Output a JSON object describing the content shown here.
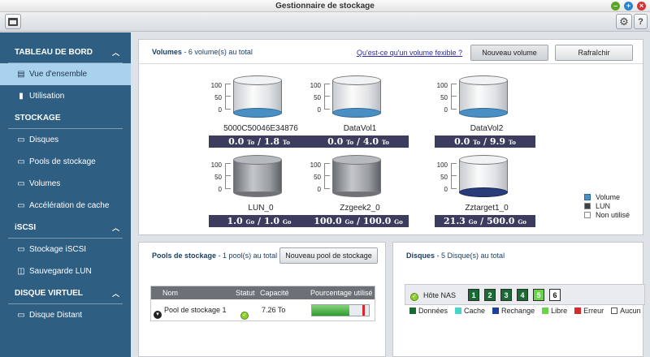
{
  "window": {
    "title": "Gestionnaire de stockage"
  },
  "sidebar": {
    "sections": [
      {
        "label": "TABLEAU DE BORD",
        "items": [
          {
            "label": "Vue d'ensemble",
            "icon": "overview-icon"
          },
          {
            "label": "Utilisation",
            "icon": "chart-icon"
          }
        ]
      },
      {
        "label": "STOCKAGE",
        "items": [
          {
            "label": "Disques",
            "icon": "disk-icon"
          },
          {
            "label": "Pools de stockage",
            "icon": "pool-icon"
          },
          {
            "label": "Volumes",
            "icon": "volume-icon"
          },
          {
            "label": "Accélération de cache",
            "icon": "cache-icon"
          }
        ]
      },
      {
        "label": "iSCSI",
        "items": [
          {
            "label": "Stockage iSCSI",
            "icon": "iscsi-icon"
          },
          {
            "label": "Sauvegarde LUN",
            "icon": "backup-icon"
          }
        ]
      },
      {
        "label": "DISQUE VIRTUEL",
        "items": [
          {
            "label": "Disque Distant",
            "icon": "remote-disk-icon"
          }
        ]
      }
    ]
  },
  "volumes": {
    "title": "Volumes",
    "count_text": "- 6 volume(s) au total",
    "link": "Qu'est-ce qu'un volume fexible ?",
    "new_button": "Nouveau volume",
    "refresh_button": "Rafraîchir",
    "ticks": [
      "100",
      "50",
      "0"
    ],
    "items": [
      {
        "name": "5000C50046E34876",
        "used": "0.0",
        "total": "1.8",
        "unit": "To",
        "style": "light",
        "fill": "blue"
      },
      {
        "name": "DataVol1",
        "used": "0.0",
        "total": "4.0",
        "unit": "To",
        "style": "light",
        "fill": "blue"
      },
      {
        "name": "DataVol2",
        "used": "0.0",
        "total": "9.9",
        "unit": "To",
        "style": "light",
        "fill": "blue"
      },
      {
        "name": "LUN_0",
        "used": "1.0",
        "total": "1.0",
        "unit": "Go",
        "style": "dark",
        "fill": "none"
      },
      {
        "name": "Zzgeek2_0",
        "used": "100.0",
        "total": "100.0",
        "unit": "Go",
        "style": "dark",
        "fill": "none"
      },
      {
        "name": "Zztarget1_0",
        "used": "21.3",
        "total": "500.0",
        "unit": "Go",
        "style": "light",
        "fill": "navy"
      }
    ],
    "legend": [
      {
        "label": "Volume",
        "color": "#4a8fc4"
      },
      {
        "label": "LUN",
        "color": "#3d4248"
      },
      {
        "label": "Non utilisé",
        "color": "#ffffff"
      }
    ]
  },
  "pools": {
    "title": "Pools de stockage",
    "count_text": "- 1 pool(s) au total",
    "new_button": "Nouveau pool de stockage",
    "columns": {
      "name": "Nom",
      "status": "Statut",
      "capacity": "Capacité",
      "usage": "Pourcentage utilisé"
    },
    "rows": [
      {
        "name": "Pool de stockage 1",
        "capacity": "7.26 To",
        "used_fraction": 0.65,
        "threshold_fraction": 0.88
      }
    ]
  },
  "disks": {
    "title": "Disques",
    "count_text": "- 5 Disque(s) au total",
    "host": "Hôte NAS",
    "slots": [
      {
        "n": "1",
        "state": "data"
      },
      {
        "n": "2",
        "state": "data"
      },
      {
        "n": "3",
        "state": "data"
      },
      {
        "n": "4",
        "state": "data"
      },
      {
        "n": "5",
        "state": "free"
      },
      {
        "n": "6",
        "state": "none"
      }
    ],
    "legend": [
      {
        "label": "Données",
        "color": "#1a6a34"
      },
      {
        "label": "Cache",
        "color": "#48d4c8"
      },
      {
        "label": "Rechange",
        "color": "#1f3f9c"
      },
      {
        "label": "Libre",
        "color": "#6bd34a"
      },
      {
        "label": "Erreur",
        "color": "#d8282c"
      },
      {
        "label": "Aucun",
        "color": "#ffffff"
      }
    ]
  }
}
